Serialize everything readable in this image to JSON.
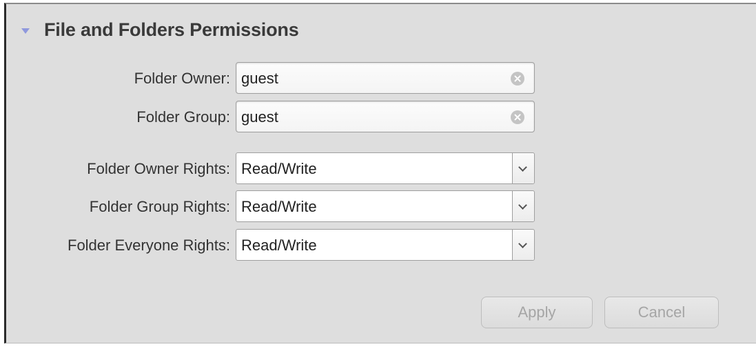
{
  "section": {
    "title": "File and Folders Permissions"
  },
  "fields": {
    "owner": {
      "label": "Folder Owner:",
      "value": "guest"
    },
    "group": {
      "label": "Folder Group:",
      "value": "guest"
    }
  },
  "rights": {
    "owner": {
      "label": "Folder Owner Rights:",
      "value": "Read/Write"
    },
    "group": {
      "label": "Folder Group Rights:",
      "value": "Read/Write"
    },
    "everyone": {
      "label": "Folder Everyone Rights:",
      "value": "Read/Write"
    }
  },
  "buttons": {
    "apply": "Apply",
    "cancel": "Cancel"
  },
  "icons": {
    "collapse": "triangle-down-icon",
    "clear": "clear-circle-x-icon",
    "dropdown": "chevron-down-icon"
  },
  "colors": {
    "panel_bg": "#dedede",
    "accent_triangle": "#8f98dd",
    "disabled_text": "#a5a5a5"
  }
}
